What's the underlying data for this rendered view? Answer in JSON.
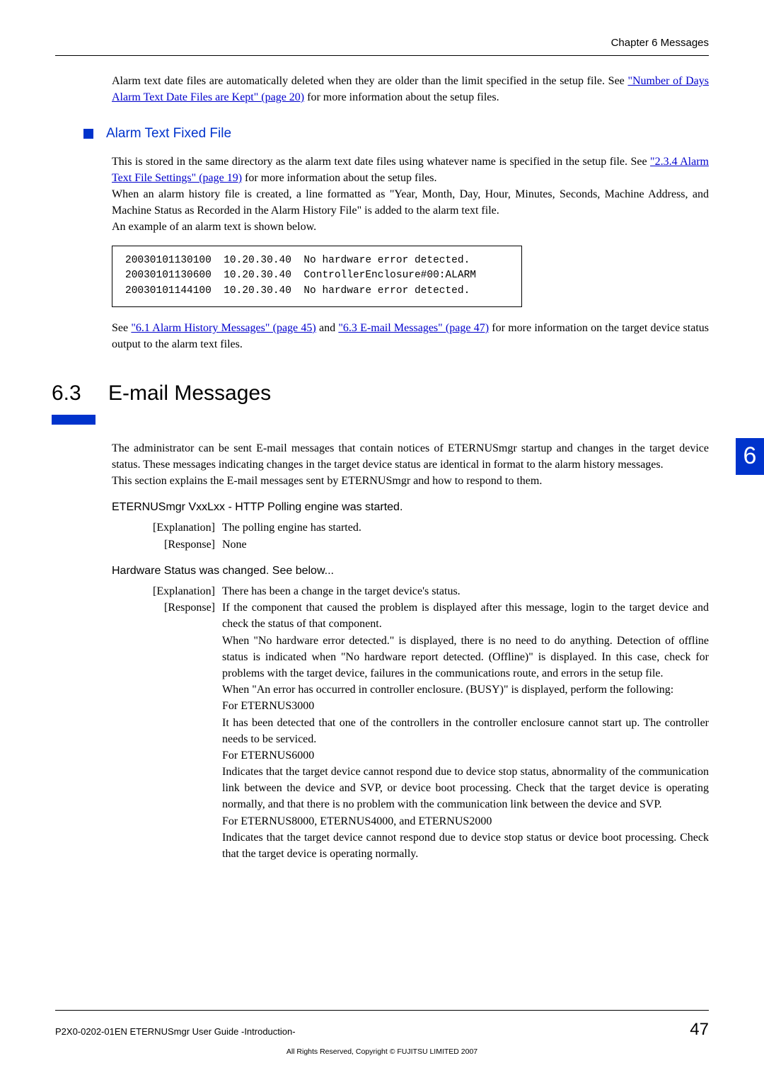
{
  "header": {
    "chapter": "Chapter 6  Messages"
  },
  "intro1": {
    "p1a": "Alarm text date files are automatically deleted when they are older than the limit specified in the setup file. See ",
    "link1": "\"Number of Days Alarm Text Date Files are Kept\" (page 20)",
    "p1b": " for more information about the setup files."
  },
  "sub1": {
    "title": "Alarm Text Fixed File",
    "p1a": "This is stored in the same directory as the alarm text date files using whatever name is specified in the setup file. See ",
    "link1": "\"2.3.4 Alarm Text File Settings\" (page 19)",
    "p1b": " for more information about the setup files.",
    "p2": "When an alarm history file is created, a line formatted as \"Year, Month, Day, Hour, Minutes, Seconds, Machine Address, and Machine Status as Recorded in the Alarm History File\" is added to the alarm text file.",
    "p3": "An example of an alarm text is shown below.",
    "code": "20030101130100  10.20.30.40  No hardware error detected.\n20030101130600  10.20.30.40  ControllerEnclosure#00:ALARM\n20030101144100  10.20.30.40  No hardware error detected.",
    "p4a": "See ",
    "link2": "\"6.1 Alarm History Messages\" (page 45)",
    "p4b": " and ",
    "link3": "\"6.3 E-mail Messages\" (page 47)",
    "p4c": " for more information on the target device status output to the alarm text files."
  },
  "sec63": {
    "num": "6.3",
    "title": "E-mail Messages",
    "p1": "The administrator can be sent E-mail messages that contain notices of ETERNUSmgr startup and changes in the target device status. These messages indicating changes in the target device status are identical in format to the alarm history messages.",
    "p2": "This section explains the E-mail messages sent by ETERNUSmgr and how to respond to them."
  },
  "labels": {
    "explanation": "[Explanation]",
    "response": "[Response]"
  },
  "msg1": {
    "title": "ETERNUSmgr VxxLxx - HTTP Polling engine was started.",
    "expl": "The polling engine has started.",
    "resp": "None"
  },
  "msg2": {
    "title": "Hardware Status was changed. See below...",
    "expl": "There has been a change in the target device's status.",
    "r1": "If the component that caused the problem is displayed after this message, login to the target device and check the status of that component.",
    "r2": "When \"No hardware error detected.\" is displayed, there is no need to do anything. Detection of offline status is indicated when \"No hardware report detected. (Offline)\" is displayed. In this case, check for problems with the target device, failures in the communications route, and errors in the setup file.",
    "r3": "When \"An error has occurred in controller enclosure. (BUSY)\" is displayed, perform the following:",
    "r4": "For ETERNUS3000",
    "r5": "It has been detected that one of the controllers in the controller enclosure cannot start up. The controller needs to be serviced.",
    "r6": "For ETERNUS6000",
    "r7": "Indicates that the target device cannot respond due to device stop status, abnormality of the communication link between the device and SVP, or device boot processing. Check that the target device is operating normally, and that there is no problem with the communication link between the device and SVP.",
    "r8": "For ETERNUS8000, ETERNUS4000, and ETERNUS2000",
    "r9": "Indicates that the target device cannot respond due to device stop status or device boot processing. Check that the target device is operating normally."
  },
  "sidetab": "6",
  "footer": {
    "left": "P2X0-0202-01EN    ETERNUSmgr User Guide -Introduction-",
    "page": "47",
    "copy": "All Rights Reserved, Copyright © FUJITSU LIMITED 2007"
  }
}
